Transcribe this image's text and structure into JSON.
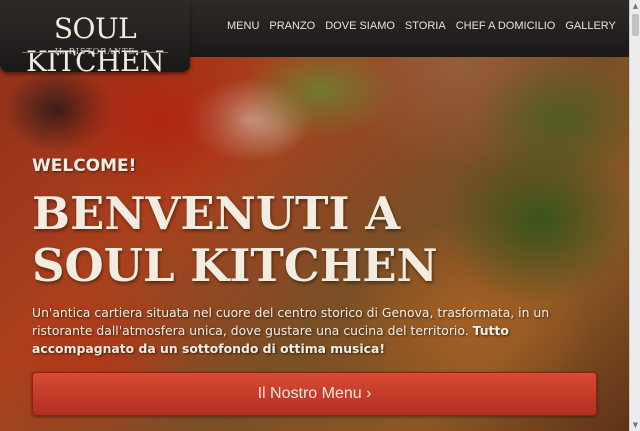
{
  "logo": {
    "title": "SOUL KITCHEN",
    "subtitle": "IL RISTORANTE"
  },
  "nav": {
    "items": [
      {
        "label": "MENU"
      },
      {
        "label": "PRANZO"
      },
      {
        "label": "DOVE SIAMO"
      },
      {
        "label": "STORIA"
      },
      {
        "label": "CHEF A DOMICILIO"
      },
      {
        "label": "GALLERY"
      }
    ]
  },
  "hero": {
    "welcome": "WELCOME!",
    "headline_line1": "BENVENUTI A",
    "headline_line2": "SOUL KITCHEN",
    "intro": "Un'antica cartiera situata nel cuore del centro storico di Genova, trasformata, in un ristorante dall'atmosfera unica, dove gustare una cucina del territorio.",
    "intro_bold": "Tutto accompagnato da un sottofondo di ottima musica!",
    "cta_label": "Il Nostro Menu ›"
  },
  "colors": {
    "cta": "#c63c28",
    "header": "#252120",
    "text": "#f4efe6"
  }
}
